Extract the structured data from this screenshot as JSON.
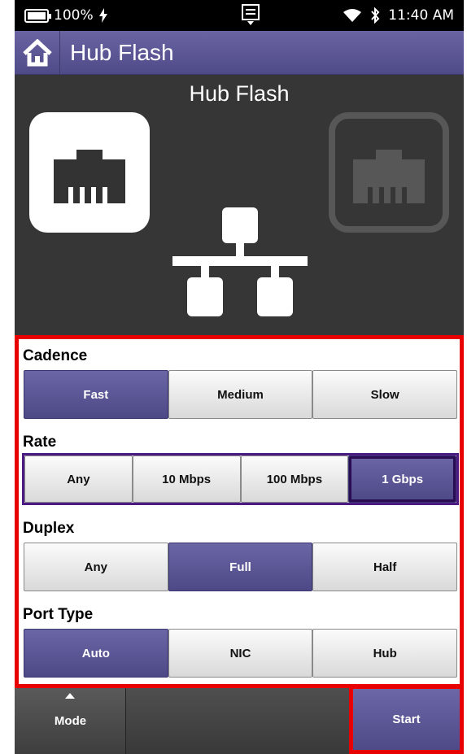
{
  "status_bar": {
    "battery": "100%",
    "battery_level": 1.0,
    "time": "11:40 AM",
    "icons": [
      "battery-icon",
      "charging-icon",
      "notification-icon",
      "wifi-icon",
      "bluetooth-icon"
    ]
  },
  "header": {
    "home_icon": "home-icon",
    "title": "Hub Flash"
  },
  "graphic": {
    "title": "Hub Flash",
    "left_port_state": "active",
    "right_port_state": "inactive"
  },
  "settings": {
    "cadence": {
      "label": "Cadence",
      "options": [
        "Fast",
        "Medium",
        "Slow"
      ],
      "selected": "Fast"
    },
    "rate": {
      "label": "Rate",
      "options": [
        "Any",
        "10 Mbps",
        "100 Mbps",
        "1 Gbps"
      ],
      "selected": "1 Gbps"
    },
    "duplex": {
      "label": "Duplex",
      "options": [
        "Any",
        "Full",
        "Half"
      ],
      "selected": "Full"
    },
    "port_type": {
      "label": "Port Type",
      "options": [
        "Auto",
        "NIC",
        "Hub"
      ],
      "selected": "Auto"
    }
  },
  "bottom_bar": {
    "mode_label": "Mode",
    "start_label": "Start"
  },
  "colors": {
    "accent": "#5a5596",
    "highlight": "#e80000",
    "dark_bg": "#363636"
  }
}
